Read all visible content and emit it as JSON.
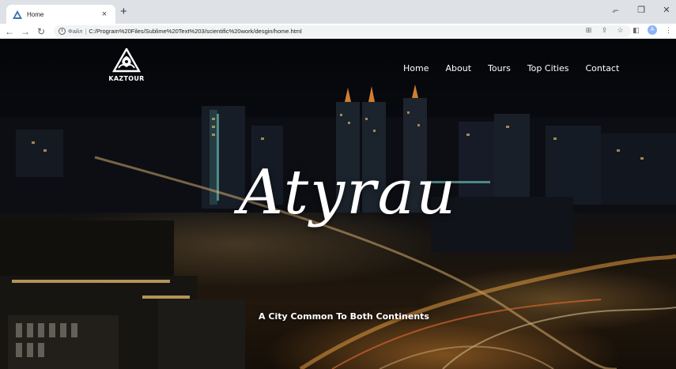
{
  "browser": {
    "tab_title": "Home",
    "tab_close": "×",
    "new_tab": "+",
    "url_scheme": "Файл",
    "url_separator": "|",
    "url_path": "C:/Program%20Files/Sublime%20Text%203/scientific%20work/desgin/home.html",
    "profile_initial": "A",
    "icons": {
      "back": "back-arrow-icon",
      "forward": "forward-arrow-icon",
      "reload": "reload-icon",
      "info": "info-icon",
      "translate": "translate-icon",
      "share": "share-icon",
      "bookmark": "star-icon",
      "sidepanel": "side-panel-icon",
      "menu": "kebab-menu-icon"
    }
  },
  "site": {
    "logo_text": "KAZTOUR",
    "nav": [
      "Home",
      "About",
      "Tours",
      "Top Cities",
      "Contact"
    ],
    "hero_title": "Atyrau",
    "hero_subtitle": "A City Common To Both Continents"
  },
  "colors": {
    "text": "#ffffff",
    "chrome_bg": "#dee1e6",
    "page_dark": "#0a0c12",
    "city_light": "#ffb347",
    "teal_light": "#7fe0d8"
  }
}
